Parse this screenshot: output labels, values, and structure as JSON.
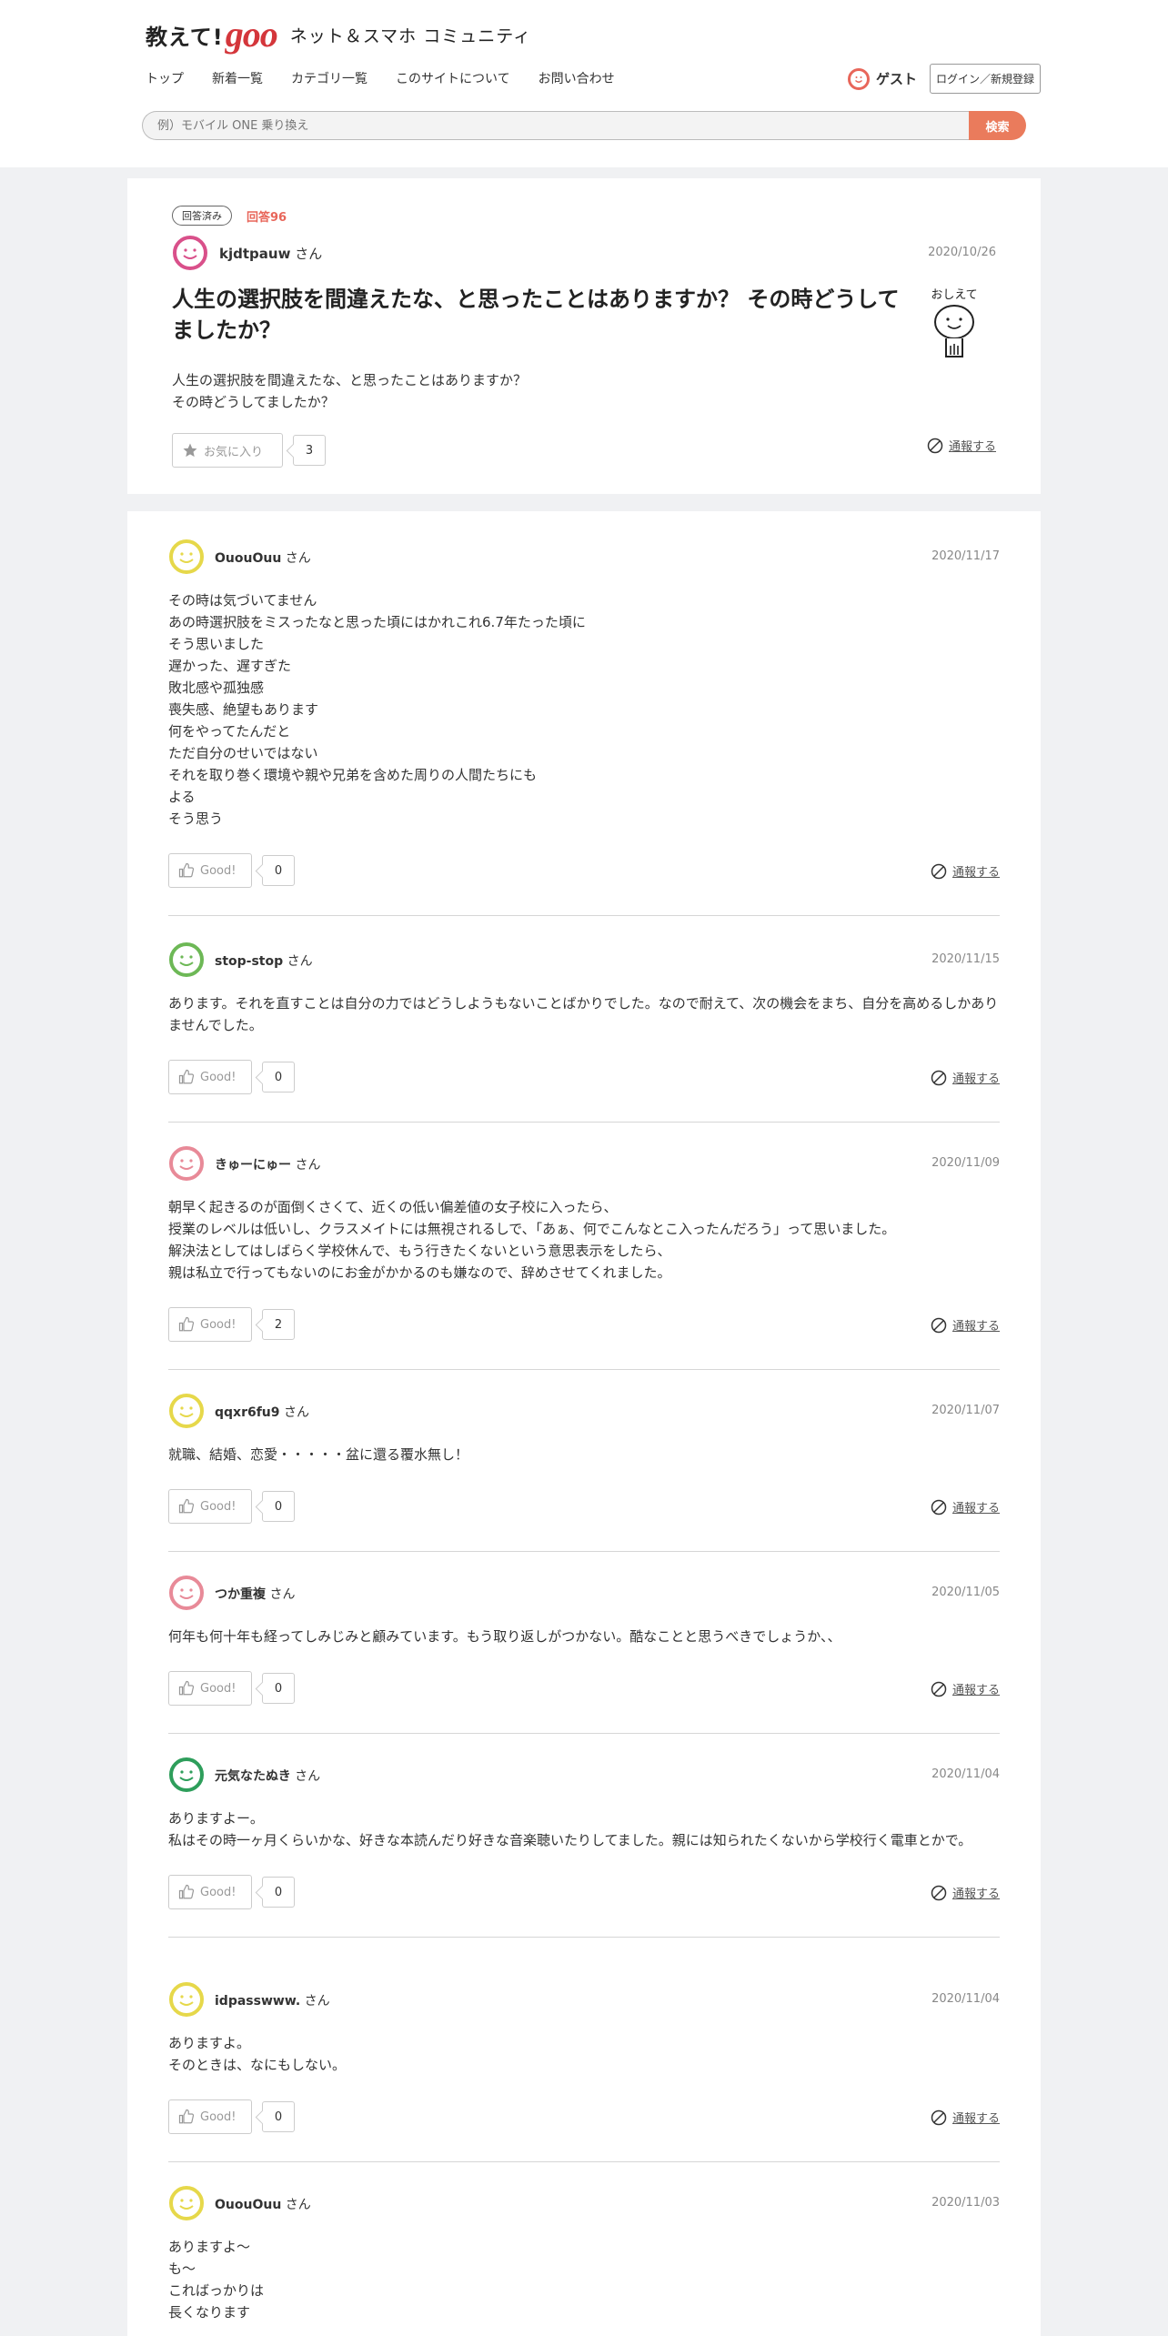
{
  "header": {
    "logo_oshiete": "教えて!",
    "logo_goo": "goo",
    "tagline": "ネット＆スマホ コミュニティ",
    "nav": [
      "トップ",
      "新着一覧",
      "カテゴリ一覧",
      "このサイトについて",
      "お問い合わせ"
    ],
    "guest_label": "ゲスト",
    "login_label": "ログイン／新規登録",
    "search_placeholder": "例）モバイル ONE 乗り換え",
    "search_button": "検索"
  },
  "question": {
    "status": "回答済み",
    "answer_count": "回答96",
    "user": "kjdtpauw",
    "honorific": " さん",
    "date": "2020/10/26",
    "title": "人生の選択肢を間違えたな、と思ったことはありますか？ その時どうしてましたか？",
    "body": "人生の選択肢を間違えたな、と思ったことはありますか？\nその時どうしてましたか？",
    "favorite_label": "お気に入り",
    "favorite_count": "3",
    "report_label": "通報する",
    "mascot_text": "おしえて",
    "avatar_color": "#d9508a"
  },
  "answers": [
    {
      "user": "OuouOuu",
      "honorific": " さん",
      "date": "2020/11/17",
      "body": "その時は気づいてません\nあの時選択肢をミスったなと思った頃にはかれこれ6.7年たった頃に\nそう思いました\n遅かった、遅すぎた\n敗北感や孤独感\n喪失感、絶望もあります\n何をやってたんだと\nただ自分のせいではない\nそれを取り巻く環境や親や兄弟を含めた周りの人間たちにも\nよる\nそう思う",
      "good_label": "Good!",
      "good_count": "0",
      "report_label": "通報する",
      "avatar_color": "#e6d84a"
    },
    {
      "user": "stop-stop",
      "honorific": " さん",
      "date": "2020/11/15",
      "body": "あります。それを直すことは自分の力ではどうしようもないことばかりでした。なので耐えて、次の機会をまち、自分を高めるしかありませんでした。",
      "good_label": "Good!",
      "good_count": "0",
      "report_label": "通報する",
      "avatar_color": "#6db856"
    },
    {
      "user": "きゅーにゅー",
      "honorific": " さん",
      "date": "2020/11/09",
      "body": "朝早く起きるのが面倒くさくて、近くの低い偏差値の女子校に入ったら、\n授業のレベルは低いし、クラスメイトには無視されるしで、「あぁ、何でこんなとこ入ったんだろう」って思いました。\n解決法としてはしばらく学校休んで、もう行きたくないという意思表示をしたら、\n親は私立で行ってもないのにお金がかかるのも嫌なので、辞めさせてくれました。",
      "good_label": "Good!",
      "good_count": "2",
      "report_label": "通報する",
      "avatar_color": "#e88a98"
    },
    {
      "user": "qqxr6fu9",
      "honorific": " さん",
      "date": "2020/11/07",
      "body": "就職、結婚、恋愛・・・・・盆に還る覆水無し！",
      "good_label": "Good!",
      "good_count": "0",
      "report_label": "通報する",
      "avatar_color": "#e6d84a"
    },
    {
      "user": "つか重複",
      "honorific": " さん",
      "date": "2020/11/05",
      "body": "何年も何十年も経ってしみじみと顧みています。もう取り返しがつかない。酷なことと思うべきでしょうか、、",
      "good_label": "Good!",
      "good_count": "0",
      "report_label": "通報する",
      "avatar_color": "#e88a98"
    },
    {
      "user": "元気なたぬき",
      "honorific": " さん",
      "date": "2020/11/04",
      "body": "ありますよー。\n私はその時一ヶ月くらいかな、好きな本読んだり好きな音楽聴いたりしてました。親には知られたくないから学校行く電車とかで。",
      "good_label": "Good!",
      "good_count": "0",
      "report_label": "通報する",
      "avatar_color": "#2e9e5b"
    },
    {
      "user": "idpasswww.",
      "honorific": " さん",
      "date": "2020/11/04",
      "body": "ありますよ。\nそのときは、なにもしない。",
      "good_label": "Good!",
      "good_count": "0",
      "report_label": "通報する",
      "avatar_color": "#e6d84a"
    },
    {
      "user": "OuouOuu",
      "honorific": " さん",
      "date": "2020/11/03",
      "body": "ありますよ～\nも～\nこればっかりは\n長くなります",
      "good_label": "Good!",
      "good_count": "0",
      "report_label": "通報する",
      "avatar_color": "#e6d84a"
    }
  ]
}
